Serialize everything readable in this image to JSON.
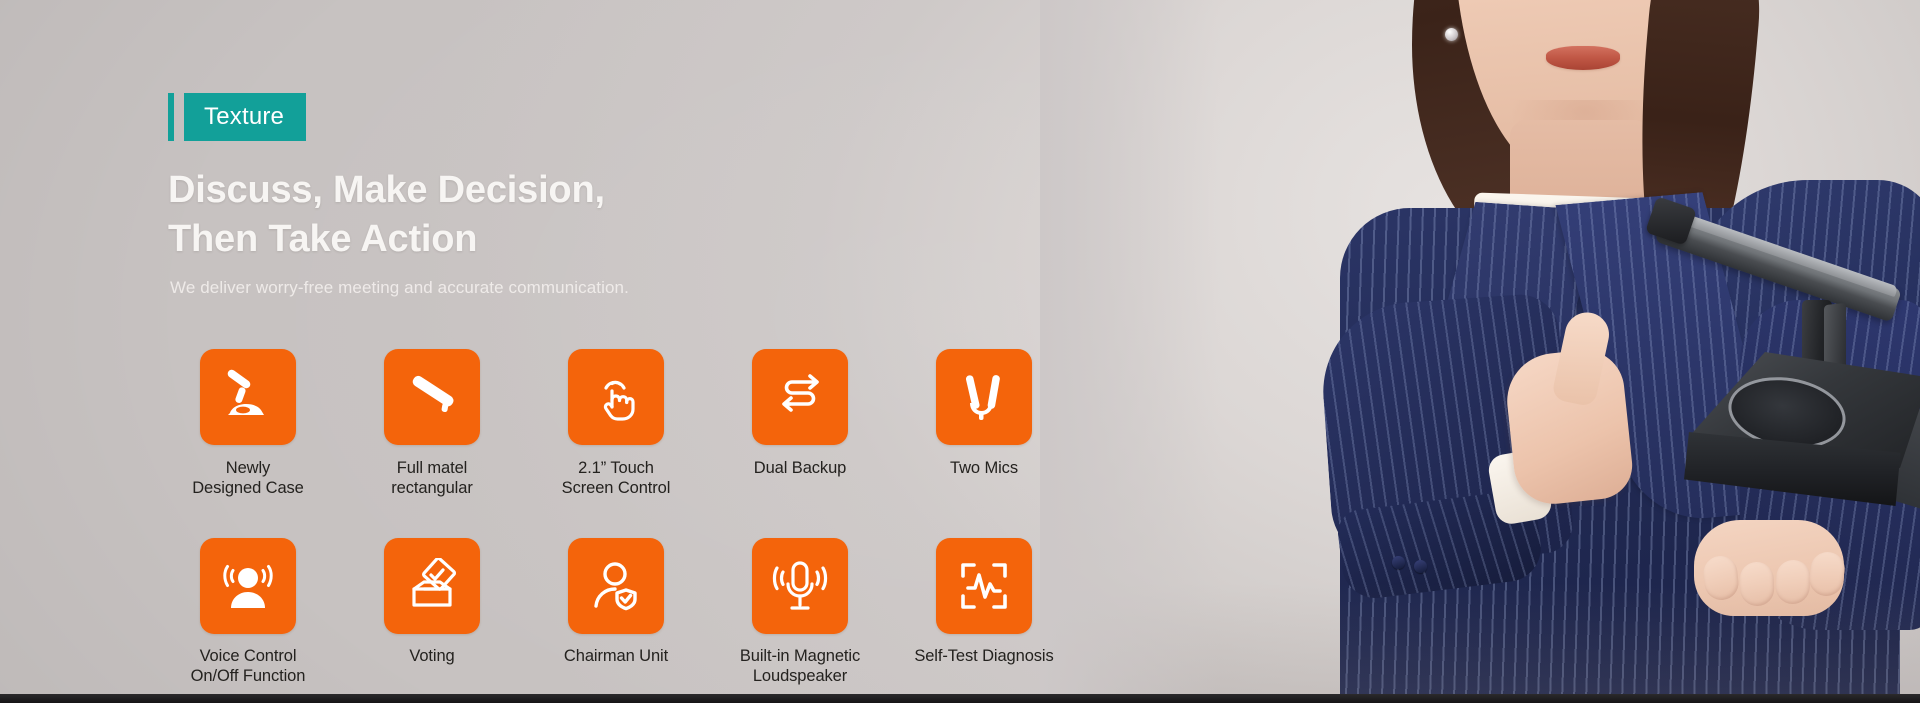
{
  "badge": {
    "label": "Texture"
  },
  "hero": {
    "headline": "Discuss, Make Decision,\nThen Take Action",
    "tagline": "We deliver worry-free meeting and accurate communication."
  },
  "colors": {
    "badge_teal": "#12a099",
    "tile_orange": "#f4640b",
    "background_gray": "#cdc8c8",
    "headline_white": "#f7f5f3",
    "label_dark": "#24221f",
    "blazer_navy": "#222b55"
  },
  "features": {
    "row1": [
      {
        "icon": "gooseneck-microphone-icon",
        "label": "Newly\nDesigned Case"
      },
      {
        "icon": "metal-bar-icon",
        "label": "Full matel\nrectangular"
      },
      {
        "icon": "touch-hand-icon",
        "label": "2.1” Touch\nScreen Control"
      },
      {
        "icon": "dual-backup-arrows-icon",
        "label": "Dual Backup"
      },
      {
        "icon": "two-mics-icon",
        "label": "Two Mics"
      }
    ],
    "row2": [
      {
        "icon": "voice-control-person-icon",
        "label": "Voice Control\nOn/Off Function"
      },
      {
        "icon": "voting-ballot-icon",
        "label": "Voting"
      },
      {
        "icon": "chairman-person-check-icon",
        "label": "Chairman Unit"
      },
      {
        "icon": "magnetic-loudspeaker-mic-icon",
        "label": "Built-in Magnetic\nLoudspeaker"
      },
      {
        "icon": "self-test-waveform-icon",
        "label": "Self-Test Diagnosis"
      }
    ]
  },
  "photo": {
    "subject": "businesswoman-holding-conference-microphone-unit",
    "gesture": "thumbs-up",
    "product": "desktop-conference-discussion-unit"
  }
}
